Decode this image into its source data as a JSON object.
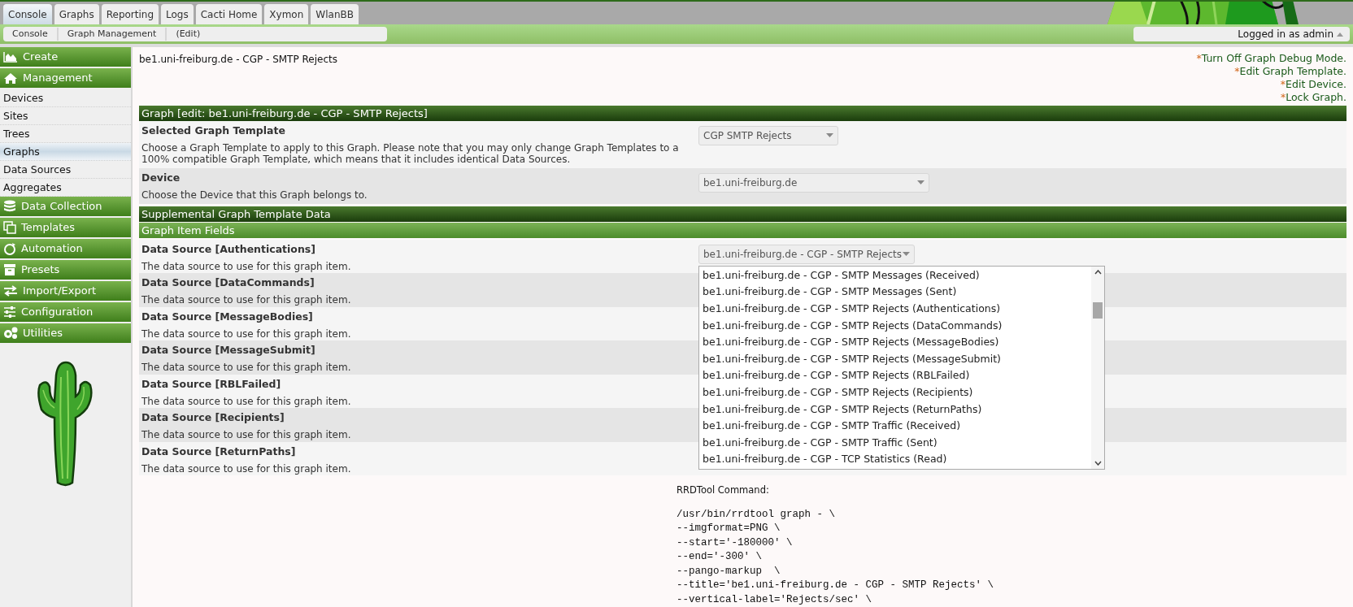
{
  "top_tabs": [
    {
      "label": "Console",
      "selected": true
    },
    {
      "label": "Graphs",
      "selected": false
    },
    {
      "label": "Reporting",
      "selected": false
    },
    {
      "label": "Logs",
      "selected": false
    },
    {
      "label": "Cacti Home",
      "selected": false
    },
    {
      "label": "Xymon",
      "selected": false
    },
    {
      "label": "WlanBB",
      "selected": false
    }
  ],
  "breadcrumb": [
    "Console",
    "Graph Management",
    "(Edit)"
  ],
  "user_menu": {
    "label": "Logged in as admin"
  },
  "sidebar": {
    "sections": [
      {
        "label": "Create"
      },
      {
        "label": "Management",
        "items": [
          {
            "label": "Devices",
            "selected": false
          },
          {
            "label": "Sites",
            "selected": false
          },
          {
            "label": "Trees",
            "selected": false
          },
          {
            "label": "Graphs",
            "selected": true
          },
          {
            "label": "Data Sources",
            "selected": false
          },
          {
            "label": "Aggregates",
            "selected": false
          }
        ]
      },
      {
        "label": "Data Collection"
      },
      {
        "label": "Templates"
      },
      {
        "label": "Automation"
      },
      {
        "label": "Presets"
      },
      {
        "label": "Import/Export"
      },
      {
        "label": "Configuration"
      },
      {
        "label": "Utilities"
      }
    ]
  },
  "page_title": "be1.uni-freiburg.de - CGP - SMTP Rejects",
  "actions": [
    {
      "bullet": "*",
      "label": "Turn Off Graph Debug Mode."
    },
    {
      "bullet": "*",
      "label": "Edit Graph Template."
    },
    {
      "bullet": "*",
      "label": "Edit Device."
    },
    {
      "bullet": "*",
      "label": "Lock Graph."
    }
  ],
  "graph_section": {
    "header": "Graph [edit: be1.uni-freiburg.de - CGP - SMTP Rejects]",
    "fields": [
      {
        "label": "Selected Graph Template",
        "description": "Choose a Graph Template to apply to this Graph. Please note that you may only change Graph Templates to a 100% compatible Graph Template, which means that it includes identical Data Sources.",
        "value": "CGP SMTP Rejects"
      },
      {
        "label": "Device",
        "description": "Choose the Device that this Graph belongs to.",
        "value": "be1.uni-freiburg.de"
      }
    ]
  },
  "supplemental": {
    "header": "Supplemental Graph Template Data",
    "subheader": "Graph Item Fields",
    "fields": [
      {
        "label": "Data Source [Authentications]",
        "description": "The data source to use for this graph item.",
        "value": "be1.uni-freiburg.de - CGP - SMTP Rejects"
      },
      {
        "label": "Data Source [DataCommands]",
        "description": "The data source to use for this graph item."
      },
      {
        "label": "Data Source [MessageBodies]",
        "description": "The data source to use for this graph item."
      },
      {
        "label": "Data Source [MessageSubmit]",
        "description": "The data source to use for this graph item."
      },
      {
        "label": "Data Source [RBLFailed]",
        "description": "The data source to use for this graph item."
      },
      {
        "label": "Data Source [Recipients]",
        "description": "The data source to use for this graph item."
      },
      {
        "label": "Data Source [ReturnPaths]",
        "description": "The data source to use for this graph item."
      }
    ]
  },
  "dropdown_list": {
    "options": [
      "be1.uni-freiburg.de - CGP - SMTP Messages (Received)",
      "be1.uni-freiburg.de - CGP - SMTP Messages (Sent)",
      "be1.uni-freiburg.de - CGP - SMTP Rejects (Authentications)",
      "be1.uni-freiburg.de - CGP - SMTP Rejects (DataCommands)",
      "be1.uni-freiburg.de - CGP - SMTP Rejects (MessageBodies)",
      "be1.uni-freiburg.de - CGP - SMTP Rejects (MessageSubmit)",
      "be1.uni-freiburg.de - CGP - SMTP Rejects (RBLFailed)",
      "be1.uni-freiburg.de - CGP - SMTP Rejects (Recipients)",
      "be1.uni-freiburg.de - CGP - SMTP Rejects (ReturnPaths)",
      "be1.uni-freiburg.de - CGP - SMTP Traffic (Received)",
      "be1.uni-freiburg.de - CGP - SMTP Traffic (Sent)",
      "be1.uni-freiburg.de - CGP - TCP Statistics (Read)"
    ]
  },
  "rrdtool": {
    "label": "RRDTool Command:",
    "lines": [
      "/usr/bin/rrdtool graph - \\",
      "--imgformat=PNG \\",
      "--start='-180000' \\",
      "--end='-300' \\",
      "--pango-markup  \\",
      "--title='be1.uni-freiburg.de - CGP - SMTP Rejects' \\",
      "--vertical-label='Rejects/sec' \\"
    ]
  }
}
